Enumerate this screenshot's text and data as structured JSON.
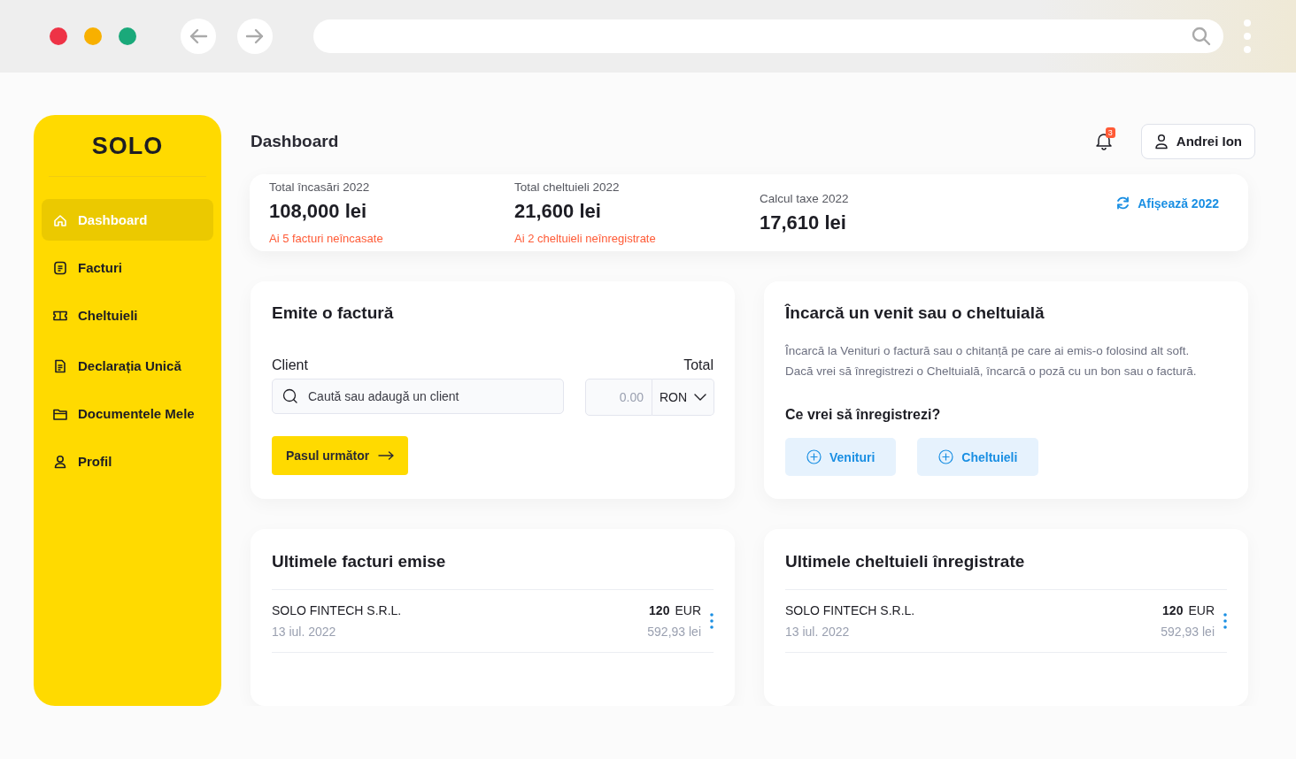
{
  "sidebar": {
    "logo": "SOLO",
    "items": [
      {
        "label": "Dashboard",
        "selected": true
      },
      {
        "label": "Facturi",
        "selected": false
      },
      {
        "label": "Cheltuieli",
        "selected": false
      },
      {
        "label": "Declarația Unică",
        "selected": false
      },
      {
        "label": "Documentele Mele",
        "selected": false
      },
      {
        "label": "Profil",
        "selected": false
      }
    ]
  },
  "header": {
    "title": "Dashboard",
    "notification_count": "3",
    "user": "Andrei Ion"
  },
  "summary": {
    "stats": [
      {
        "label": "Total încasări 2022",
        "value": "108,000 lei",
        "note": "Ai 5 facturi neîncasate"
      },
      {
        "label": "Total cheltuieli 2022",
        "value": "21,600 lei",
        "note": "Ai 2 cheltuieli neînregistrate"
      },
      {
        "label": "Calcul taxe 2022",
        "value": "17,610 lei"
      }
    ],
    "action": "Afișează 2022"
  },
  "invoice_form": {
    "title": "Emite o factură",
    "client_label": "Client",
    "client_placeholder": "Caută sau adaugă un client",
    "total_label": "Total",
    "amount_placeholder": "0.00",
    "currency": "RON",
    "next_button": "Pasul următor"
  },
  "upload": {
    "title": "Încarcă un venit sau o cheltuială",
    "description_lines": [
      "Încarcă la Venituri o factură sau o chitanță pe care ai emis-o folosind alt soft.",
      "Dacă vrei să înregistrezi o Cheltuială, încarcă o poză cu un bon sau o factură."
    ],
    "question": "Ce vrei să înregistrezi?",
    "buttons": [
      "Venituri",
      "Cheltuieli"
    ]
  },
  "recent_invoices": {
    "title": "Ultimele facturi emise",
    "rows": [
      {
        "name": "SOLO FINTECH S.R.L.",
        "date": "13 iul. 2022",
        "amount": "120",
        "currency": "EUR",
        "converted": "592,93 lei"
      }
    ]
  },
  "recent_expenses": {
    "title": "Ultimele cheltuieli înregistrate",
    "rows": [
      {
        "name": "SOLO FINTECH S.R.L.",
        "date": "13 iul. 2022",
        "amount": "120",
        "currency": "EUR",
        "converted": "592,93 lei"
      }
    ]
  }
}
